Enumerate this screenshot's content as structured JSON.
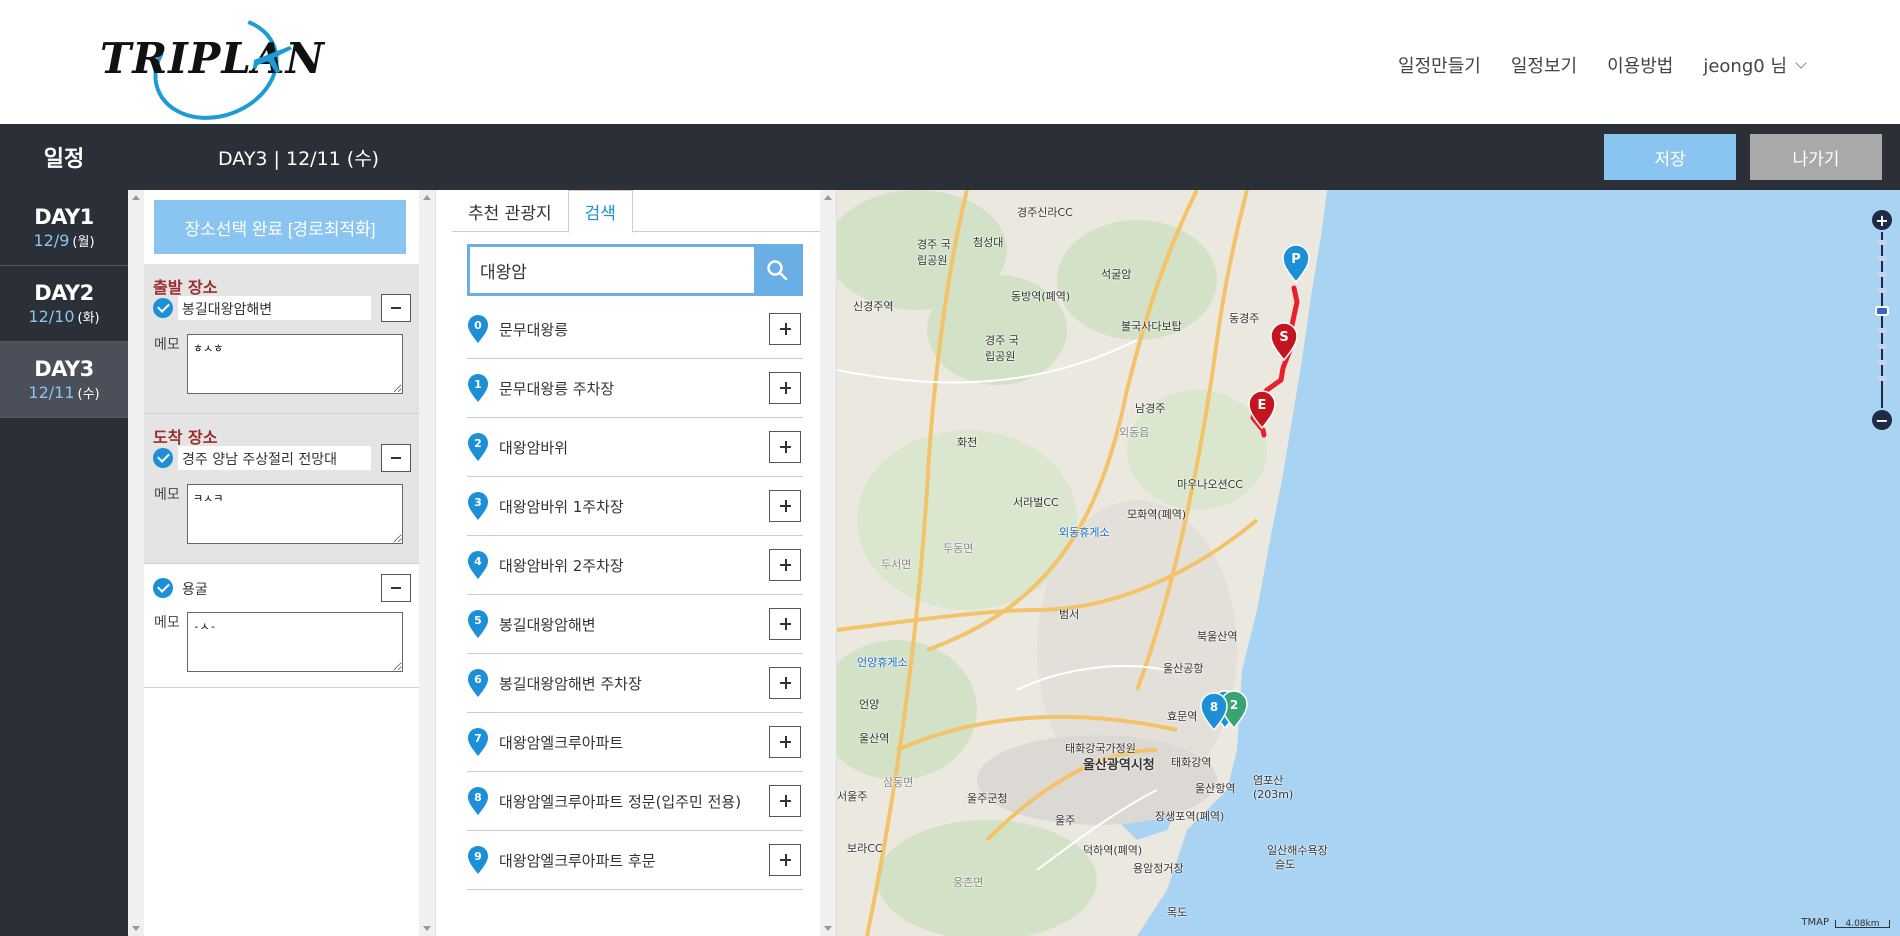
{
  "brand": {
    "name": "TRIPLAN"
  },
  "topnav": {
    "items": [
      "일정만들기",
      "일정보기",
      "이용방법"
    ],
    "user": "jeong0 님"
  },
  "schedule": {
    "title": "일정",
    "current_day": "DAY3 | 12/11 (수)",
    "save_label": "저장",
    "exit_label": "나가기"
  },
  "days": [
    {
      "name": "DAY1",
      "date": "12/9",
      "dow": "(월)"
    },
    {
      "name": "DAY2",
      "date": "12/10",
      "dow": "(화)"
    },
    {
      "name": "DAY3",
      "date": "12/11",
      "dow": "(수)",
      "active": true
    }
  ],
  "places": {
    "complete_label": "장소선택 완료 [경로최적화]",
    "memo_label": "메모",
    "departure": {
      "label": "출발 장소",
      "name": "봉길대왕암해변",
      "memo": "ㅎㅅㅎ"
    },
    "arrival": {
      "label": "도착 장소",
      "name": "경주 양남 주상절리 전망대",
      "memo": "ㅋㅅㅋ"
    },
    "stops": [
      {
        "name": "용굴",
        "memo": "-ㅅ-"
      }
    ]
  },
  "search": {
    "tabs": [
      "추천 관광지",
      "검색"
    ],
    "active_tab": 1,
    "query": "대왕암",
    "results": [
      {
        "num": "0",
        "name": "문무대왕릉"
      },
      {
        "num": "1",
        "name": "문무대왕릉 주차장"
      },
      {
        "num": "2",
        "name": "대왕암바위"
      },
      {
        "num": "3",
        "name": "대왕암바위 1주차장"
      },
      {
        "num": "4",
        "name": "대왕암바위 2주차장"
      },
      {
        "num": "5",
        "name": "봉길대왕암해변"
      },
      {
        "num": "6",
        "name": "봉길대왕암해변 주차장"
      },
      {
        "num": "7",
        "name": "대왕암엘크루아파트"
      },
      {
        "num": "8",
        "name": "대왕암엘크루아파트 정문(입주민 전용)"
      },
      {
        "num": "9",
        "name": "대왕암엘크루아파트 후문"
      }
    ]
  },
  "map": {
    "labels": [
      "경주신라CC",
      "첨성대",
      "경주 국립공원",
      "석굴암",
      "동방역(폐역)",
      "신경주역",
      "불국사다보탑",
      "동경주",
      "경주 국립공원",
      "남경주",
      "화천",
      "외동읍",
      "마우나오션CC",
      "서라벌CC",
      "모화역(폐역)",
      "외동휴게소",
      "두동면",
      "두서면",
      "범서",
      "북울산역",
      "울산공항",
      "언양휴게소",
      "언양",
      "울산역",
      "효문역",
      "태화강국가정원",
      "울산광역시청",
      "태화강역",
      "울산항역",
      "염포산 (203m)",
      "장생포역(폐역)",
      "울주군청",
      "울주",
      "덕하역(폐역)",
      "용암정거장",
      "일산해수욕장",
      "슬도",
      "보라CC",
      "서울주",
      "삼동면",
      "웅촌면",
      "목도"
    ],
    "markers": {
      "p": "P",
      "s": "S",
      "e": "E",
      "eight": "8",
      "two": "2"
    },
    "scale": "4.08km",
    "provider": "TMAP",
    "colors": {
      "sea": "#a9d3f2",
      "land": "#ebe8df",
      "route": "#e8202a",
      "pin": "#1c8fd6"
    }
  }
}
